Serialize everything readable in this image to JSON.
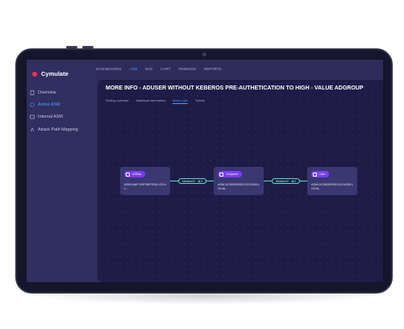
{
  "app": {
    "name": "Cymulate"
  },
  "sidebar": {
    "items": [
      {
        "label": "Overview"
      },
      {
        "label": "Active ASM"
      },
      {
        "label": "Internal ASM"
      },
      {
        "label": "Attack Path Mapping"
      }
    ]
  },
  "topnav": {
    "items": [
      "DASHBOARDS",
      "ASM",
      "BAS",
      "CART",
      "FINDINGS",
      "REPORTS"
    ],
    "active": "ASM"
  },
  "panel": {
    "title": "MORE INFO - ADUSER WITHOUT KEBEROS PRE-AUTHETICATION TO HIGH - VALUE ADGROUP",
    "tabs": [
      "Finding overview",
      "Additional information",
      "Attack path",
      "Tickets"
    ],
    "active_tab": "Attack path"
  },
  "graph": {
    "nodes": [
      {
        "badge": "ASRep",
        "text": "ASM-MAP-DEFINITION.LOCAL..."
      },
      {
        "badge": "Computer",
        "text": "ASM-DC00000000.DC01000.LOCAL"
      },
      {
        "badge": "User",
        "text": "ASM-DC00000000.DC01000.LOCAL"
      }
    ],
    "edges": [
      {
        "label": "MemberOf",
        "count": "2"
      },
      {
        "label": "MemberOf",
        "count": "2"
      }
    ]
  },
  "colors": {
    "accent": "#7a3cff",
    "edge": "#52e0c4",
    "brand": "#ff2d55",
    "link": "#4a9cff"
  }
}
